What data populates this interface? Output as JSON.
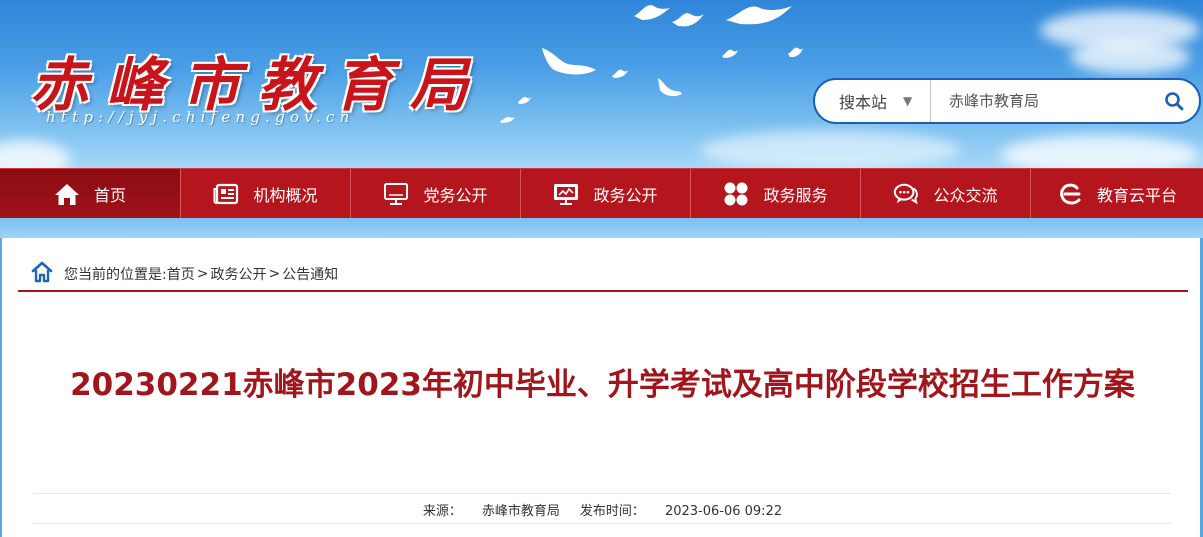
{
  "header": {
    "logo_text": "赤峰市教育局",
    "url_text": "http://jyj.chifeng.gov.cn"
  },
  "search": {
    "scope_label": "搜本站",
    "placeholder": "赤峰市教育局",
    "icons": {
      "dropdown": "caret-down-icon",
      "submit": "search-icon"
    }
  },
  "nav": {
    "items": [
      {
        "label": "首页",
        "icon": "home-icon",
        "active": true
      },
      {
        "label": "机构概况",
        "icon": "newspaper-icon"
      },
      {
        "label": "党务公开",
        "icon": "monitor-icon"
      },
      {
        "label": "政务公开",
        "icon": "screen-icon"
      },
      {
        "label": "政务服务",
        "icon": "grid-icon"
      },
      {
        "label": "公众交流",
        "icon": "chat-icon"
      },
      {
        "label": "教育云平台",
        "icon": "cloud-e-icon"
      }
    ]
  },
  "breadcrumb": {
    "prefix": "您当前的位置是:",
    "items": [
      "首页",
      "政务公开",
      "公告通知"
    ],
    "separator": ">"
  },
  "article": {
    "title": "20230221赤峰市2023年初中毕业、升学考试及高中阶段学校招生工作方案",
    "source_label": "来源：",
    "source": "赤峰市教育局",
    "date_label": "发布时间：",
    "date": "2023-06-06 09:22"
  },
  "colors": {
    "brand_red": "#b5151d",
    "title_red": "#a1161c",
    "search_border": "#1b5fb0"
  }
}
